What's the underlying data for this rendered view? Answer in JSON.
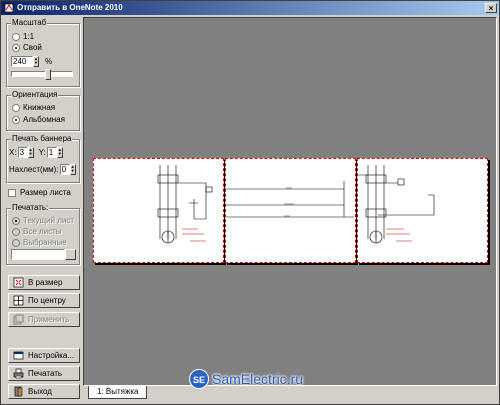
{
  "window": {
    "title": "Отправить в OneNote 2010",
    "close_glyph": "×"
  },
  "scale": {
    "legend": "Масштаб",
    "option_1to1": "1:1",
    "option_custom": "Свой",
    "percent_value": "240",
    "percent_label": "%"
  },
  "orientation": {
    "legend": "Ориентация",
    "portrait": "Книжная",
    "landscape": "Альбомная"
  },
  "banner": {
    "legend": "Печать баннера",
    "x_label": "X:",
    "x_value": "3",
    "y_label": "Y:",
    "y_value": "1",
    "overlap_label": "Нахлест(мм):",
    "overlap_value": "0"
  },
  "sheet_size_label": "Размер листа",
  "print_range": {
    "legend": "Печатать:",
    "current": "Текущий лист",
    "all": "Все листы",
    "selected": "Выбранные"
  },
  "buttons": {
    "fit": "В размер",
    "center": "По центру",
    "apply": "Применить",
    "settings": "Настройка...",
    "print": "Печатать",
    "exit": "Выход"
  },
  "tabs": [
    "1: Вытяжка"
  ],
  "watermark": {
    "logo": "SE",
    "text": "SamElectric.ru"
  },
  "icons": [
    "window-icon",
    "fit-icon",
    "center-icon",
    "apply-icon",
    "settings-icon",
    "print-icon",
    "exit-icon"
  ]
}
